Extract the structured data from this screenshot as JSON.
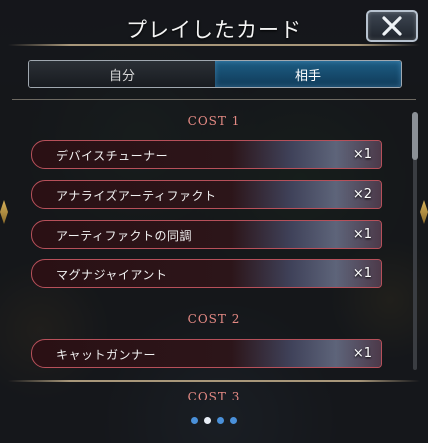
{
  "dialog": {
    "title": "プレイしたカード",
    "close_icon": "close-x-icon"
  },
  "tabs": [
    {
      "label": "自分",
      "active": false
    },
    {
      "label": "相手",
      "active": true
    }
  ],
  "groups": [
    {
      "header": "COST 1",
      "cards": [
        {
          "name": "デバイスチューナー",
          "count": "×1"
        },
        {
          "name": "アナライズアーティファクト",
          "count": "×2"
        },
        {
          "name": "アーティファクトの同調",
          "count": "×1"
        },
        {
          "name": "マグナジャイアント",
          "count": "×1"
        }
      ]
    },
    {
      "header": "COST 2",
      "cards": [
        {
          "name": "キャットガンナー",
          "count": "×1"
        }
      ]
    },
    {
      "header": "COST 3",
      "cards": []
    }
  ],
  "pager": {
    "total": 4,
    "current": 2
  },
  "colors": {
    "cost_header": "#e58a84",
    "card_border": "#b7505a",
    "active_tab": "#1d5d84",
    "pager_dot": "#4a90d9"
  }
}
